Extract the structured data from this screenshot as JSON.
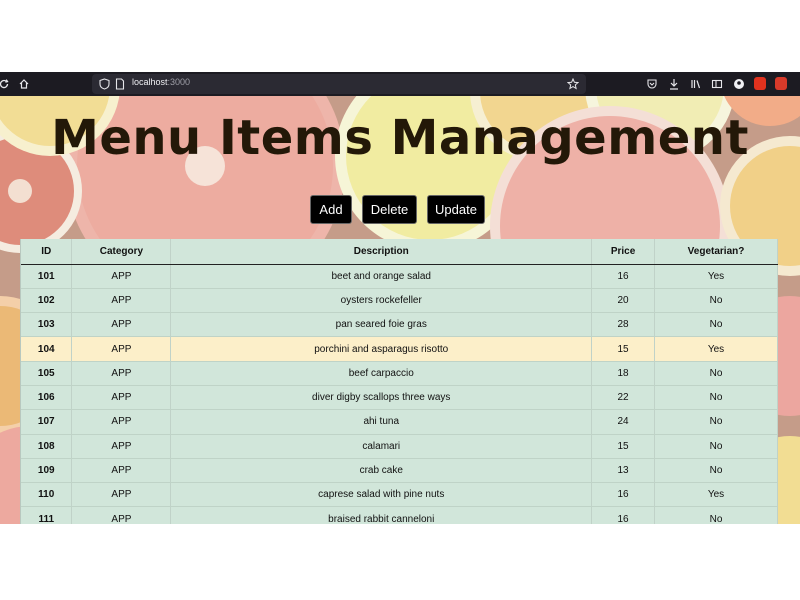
{
  "browser": {
    "url_host": "localhost",
    "url_port": ":3000"
  },
  "page": {
    "title": "Menu Items Management",
    "buttons": {
      "add": "Add",
      "delete": "Delete",
      "update": "Update"
    }
  },
  "table": {
    "headers": [
      "ID",
      "Category",
      "Description",
      "Price",
      "Vegetarian?"
    ],
    "rows": [
      {
        "id": "101",
        "category": "APP",
        "description": "beet and orange salad",
        "price": "16",
        "vegetarian": "Yes"
      },
      {
        "id": "102",
        "category": "APP",
        "description": "oysters rockefeller",
        "price": "20",
        "vegetarian": "No"
      },
      {
        "id": "103",
        "category": "APP",
        "description": "pan seared foie gras",
        "price": "28",
        "vegetarian": "No"
      },
      {
        "id": "104",
        "category": "APP",
        "description": "porchini and asparagus risotto",
        "price": "15",
        "vegetarian": "Yes"
      },
      {
        "id": "105",
        "category": "APP",
        "description": "beef carpaccio",
        "price": "18",
        "vegetarian": "No"
      },
      {
        "id": "106",
        "category": "APP",
        "description": "diver digby scallops three ways",
        "price": "22",
        "vegetarian": "No"
      },
      {
        "id": "107",
        "category": "APP",
        "description": "ahi tuna",
        "price": "24",
        "vegetarian": "No"
      },
      {
        "id": "108",
        "category": "APP",
        "description": "calamari",
        "price": "15",
        "vegetarian": "No"
      },
      {
        "id": "109",
        "category": "APP",
        "description": "crab cake",
        "price": "13",
        "vegetarian": "No"
      },
      {
        "id": "110",
        "category": "APP",
        "description": "caprese salad with pine nuts",
        "price": "16",
        "vegetarian": "Yes"
      },
      {
        "id": "111",
        "category": "APP",
        "description": "braised rabbit canneloni",
        "price": "16",
        "vegetarian": "No"
      }
    ],
    "highlighted_row_id": "104"
  },
  "colors": {
    "toolbar": "#1c1b22",
    "table_bg": "#d1e6da",
    "row_highlight": "#fcefc9",
    "title_text": "#231808"
  }
}
